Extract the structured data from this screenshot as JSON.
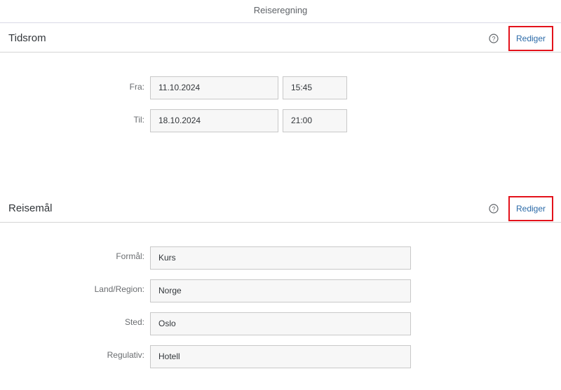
{
  "page": {
    "title": "Reiseregning"
  },
  "periode": {
    "title": "Tidsrom",
    "edit_label": "Rediger",
    "fields": {
      "fra_label": "Fra:",
      "fra_date": "11.10.2024",
      "fra_time": "15:45",
      "til_label": "Til:",
      "til_date": "18.10.2024",
      "til_time": "21:00"
    }
  },
  "destination": {
    "title": "Reisemål",
    "edit_label": "Rediger",
    "fields": {
      "formal_label": "Formål:",
      "formal_value": "Kurs",
      "land_label": "Land/Region:",
      "land_value": "Norge",
      "sted_label": "Sted:",
      "sted_value": "Oslo",
      "regulativ_label": "Regulativ:",
      "regulativ_value": "Hotell"
    }
  },
  "icons": {
    "help": "help-circle-icon"
  },
  "colors": {
    "highlight_border": "#e3121b",
    "link": "#2b6aa8"
  }
}
